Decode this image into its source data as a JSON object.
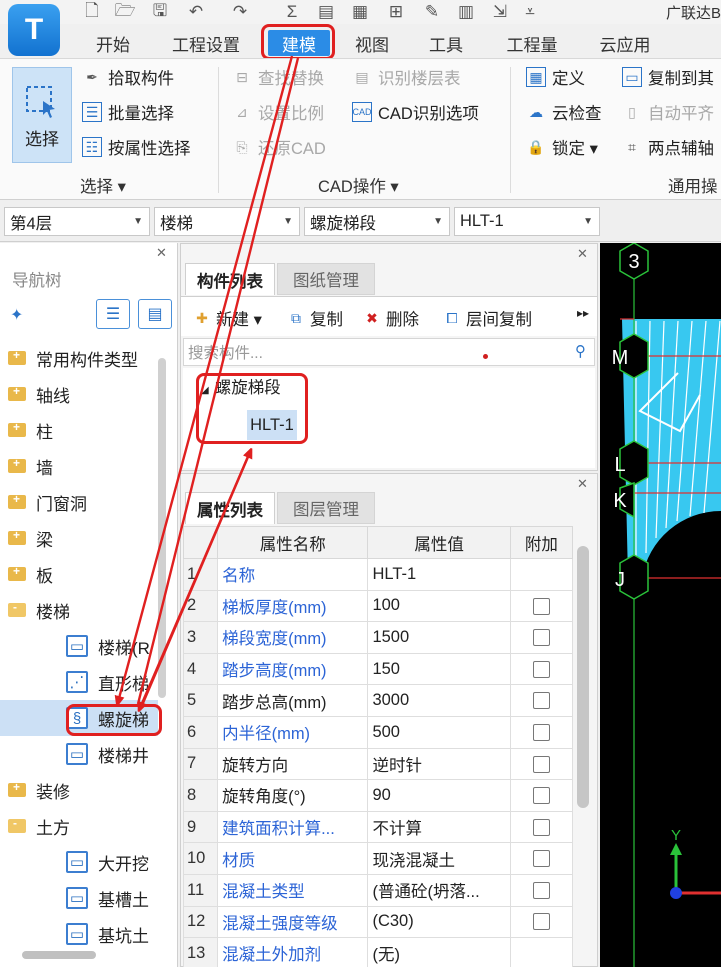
{
  "app": {
    "brand": "广联达B",
    "logo_letter": "T"
  },
  "menu": {
    "tabs": [
      "开始",
      "工程设置",
      "建模",
      "视图",
      "工具",
      "工程量",
      "云应用"
    ],
    "active": "建模"
  },
  "ribbon": {
    "select_label": "选择",
    "select_group": {
      "items": [
        "拾取构件",
        "批量选择",
        "按属性选择"
      ],
      "label": "选择 ▾"
    },
    "cad_group": {
      "items": [
        "查找替换",
        "识别楼层表",
        "设置比例",
        "CAD识别选项",
        "还原CAD"
      ],
      "label": "CAD操作 ▾"
    },
    "common_group": {
      "items": [
        "定义",
        "复制到其",
        "云检查",
        "自动平齐",
        "锁定 ▾",
        "两点辅轴"
      ],
      "label": "通用操"
    }
  },
  "dropdowns": [
    "第4层",
    "楼梯",
    "螺旋梯段",
    "HLT-1"
  ],
  "nav": {
    "title": "导航树",
    "items": [
      {
        "label": "常用构件类型",
        "type": "folder"
      },
      {
        "label": "轴线",
        "type": "folder"
      },
      {
        "label": "柱",
        "type": "folder"
      },
      {
        "label": "墙",
        "type": "folder"
      },
      {
        "label": "门窗洞",
        "type": "folder"
      },
      {
        "label": "梁",
        "type": "folder"
      },
      {
        "label": "板",
        "type": "folder"
      },
      {
        "label": "楼梯",
        "type": "open"
      },
      {
        "label": "楼梯(R",
        "type": "sub",
        "icon": "stair-r-icon"
      },
      {
        "label": "直形梯",
        "type": "sub",
        "icon": "straight-stair-icon"
      },
      {
        "label": "螺旋梯",
        "type": "sub",
        "icon": "spiral-stair-icon",
        "selected": true
      },
      {
        "label": "楼梯井",
        "type": "sub",
        "icon": "stairwell-icon"
      },
      {
        "label": "装修",
        "type": "folder"
      },
      {
        "label": "土方",
        "type": "open"
      },
      {
        "label": "大开挖",
        "type": "sub",
        "icon": "excavation-icon"
      },
      {
        "label": "基槽土",
        "type": "sub",
        "icon": "trench-icon"
      },
      {
        "label": "基坑土",
        "type": "sub",
        "icon": "pit-icon"
      }
    ]
  },
  "components": {
    "tabs": [
      "构件列表",
      "图纸管理"
    ],
    "toolbar": [
      "新建 ▾",
      "复制",
      "删除",
      "层间复制"
    ],
    "search_placeholder": "搜索构件...",
    "tree": {
      "group": "螺旋梯段",
      "item": "HLT-1"
    }
  },
  "properties": {
    "tabs": [
      "属性列表",
      "图层管理"
    ],
    "headers": [
      "属性名称",
      "属性值",
      "附加"
    ],
    "rows": [
      {
        "n": "1",
        "name": "名称",
        "value": "HLT-1",
        "blue": true,
        "cb": false
      },
      {
        "n": "2",
        "name": "梯板厚度(mm)",
        "value": "100",
        "blue": true,
        "cb": true
      },
      {
        "n": "3",
        "name": "梯段宽度(mm)",
        "value": "1500",
        "blue": true,
        "cb": true
      },
      {
        "n": "4",
        "name": "踏步高度(mm)",
        "value": "150",
        "blue": true,
        "cb": true
      },
      {
        "n": "5",
        "name": "踏步总高(mm)",
        "value": "3000",
        "blue": false,
        "cb": true
      },
      {
        "n": "6",
        "name": "内半径(mm)",
        "value": "500",
        "blue": true,
        "cb": true
      },
      {
        "n": "7",
        "name": "旋转方向",
        "value": "逆时针",
        "blue": false,
        "cb": true
      },
      {
        "n": "8",
        "name": "旋转角度(°)",
        "value": "90",
        "blue": false,
        "cb": true
      },
      {
        "n": "9",
        "name": "建筑面积计算...",
        "value": "不计算",
        "blue": true,
        "cb": true
      },
      {
        "n": "10",
        "name": "材质",
        "value": "现浇混凝土",
        "blue": true,
        "cb": true
      },
      {
        "n": "11",
        "name": "混凝土类型",
        "value": "(普通砼(坍落...",
        "blue": true,
        "cb": true
      },
      {
        "n": "12",
        "name": "混凝土强度等级",
        "value": "(C30)",
        "blue": true,
        "cb": true
      },
      {
        "n": "13",
        "name": "混凝土外加剂",
        "value": "(无)",
        "blue": true,
        "cb": false
      }
    ]
  },
  "canvas": {
    "axis_labels": [
      "3",
      "M",
      "L",
      "K",
      "J"
    ],
    "y_axis": "Y"
  },
  "colors": {
    "accent": "#2b8ce6",
    "highlight": "#e02020",
    "stair_fill": "#38c8f0",
    "link_blue": "#2c64d6"
  }
}
